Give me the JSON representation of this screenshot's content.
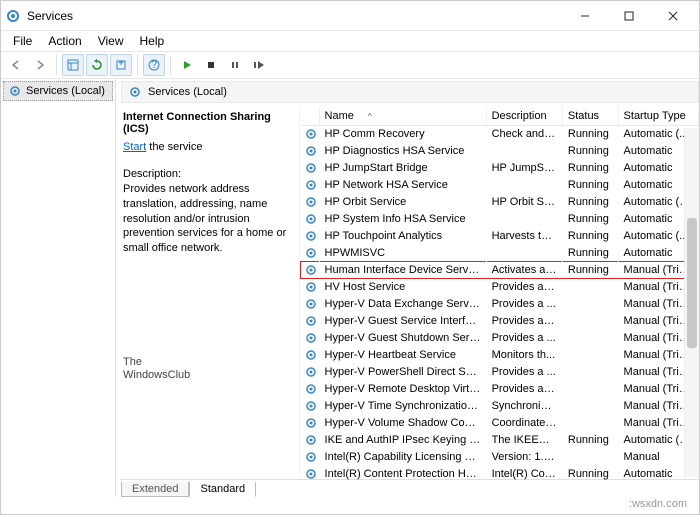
{
  "window": {
    "title": "Services"
  },
  "menu": [
    "File",
    "Action",
    "View",
    "Help"
  ],
  "leftpane": {
    "root": "Services (Local)"
  },
  "panehead": "Services (Local)",
  "detail": {
    "title": "Internet Connection Sharing (ICS)",
    "startlink": "Start",
    "startrest": " the service",
    "desc_label": "Description:",
    "desc": "Provides network address translation, addressing, name resolution and/or intrusion prevention services for a home or small office network."
  },
  "watermark": {
    "l1": "The",
    "l2": "WindowsClub"
  },
  "cols": {
    "name": "Name",
    "desc": "Description",
    "status": "Status",
    "startup": "Startup Type"
  },
  "rows": [
    {
      "name": "HP Comm Recovery",
      "desc": "Check and r...",
      "status": "Running",
      "startup": "Automatic (..."
    },
    {
      "name": "HP Diagnostics HSA Service",
      "desc": "",
      "status": "Running",
      "startup": "Automatic"
    },
    {
      "name": "HP JumpStart Bridge",
      "desc": "HP JumpSta...",
      "status": "Running",
      "startup": "Automatic"
    },
    {
      "name": "HP Network HSA Service",
      "desc": "",
      "status": "Running",
      "startup": "Automatic"
    },
    {
      "name": "HP Orbit Service",
      "desc": "HP Orbit Se...",
      "status": "Running",
      "startup": "Automatic (T..."
    },
    {
      "name": "HP System Info HSA Service",
      "desc": "",
      "status": "Running",
      "startup": "Automatic"
    },
    {
      "name": "HP Touchpoint Analytics",
      "desc": "Harvests tel...",
      "status": "Running",
      "startup": "Automatic (..."
    },
    {
      "name": "HPWMISVC",
      "desc": "",
      "status": "Running",
      "startup": "Automatic"
    },
    {
      "name": "Human Interface Device Service",
      "desc": "Activates an...",
      "status": "Running",
      "startup": "Manual (Trig...",
      "hl": true
    },
    {
      "name": "HV Host Service",
      "desc": "Provides an ...",
      "status": "",
      "startup": "Manual (Trig..."
    },
    {
      "name": "Hyper-V Data Exchange Service",
      "desc": "Provides a ...",
      "status": "",
      "startup": "Manual (Trig..."
    },
    {
      "name": "Hyper-V Guest Service Interface",
      "desc": "Provides an ...",
      "status": "",
      "startup": "Manual (Trig..."
    },
    {
      "name": "Hyper-V Guest Shutdown Service",
      "desc": "Provides a ...",
      "status": "",
      "startup": "Manual (Trig..."
    },
    {
      "name": "Hyper-V Heartbeat Service",
      "desc": "Monitors th...",
      "status": "",
      "startup": "Manual (Trig..."
    },
    {
      "name": "Hyper-V PowerShell Direct Service",
      "desc": "Provides a ...",
      "status": "",
      "startup": "Manual (Trig..."
    },
    {
      "name": "Hyper-V Remote Desktop Virtualiz...",
      "desc": "Provides a p...",
      "status": "",
      "startup": "Manual (Trig..."
    },
    {
      "name": "Hyper-V Time Synchronization Se...",
      "desc": "Synchronize...",
      "status": "",
      "startup": "Manual (Trig..."
    },
    {
      "name": "Hyper-V Volume Shadow Copy Re...",
      "desc": "Coordinates...",
      "status": "",
      "startup": "Manual (Trig..."
    },
    {
      "name": "IKE and AuthIP IPsec Keying Modu...",
      "desc": "The IKEEXT ...",
      "status": "Running",
      "startup": "Automatic (T..."
    },
    {
      "name": "Intel(R) Capability Licensing Servi...",
      "desc": "Version: 1.6...",
      "status": "",
      "startup": "Manual"
    },
    {
      "name": "Intel(R) Content Protection HDCP ...",
      "desc": "Intel(R) Con...",
      "status": "Running",
      "startup": "Automatic"
    }
  ],
  "tabs": {
    "extended": "Extended",
    "standard": "Standard"
  },
  "footer": ":wsxdn.com"
}
